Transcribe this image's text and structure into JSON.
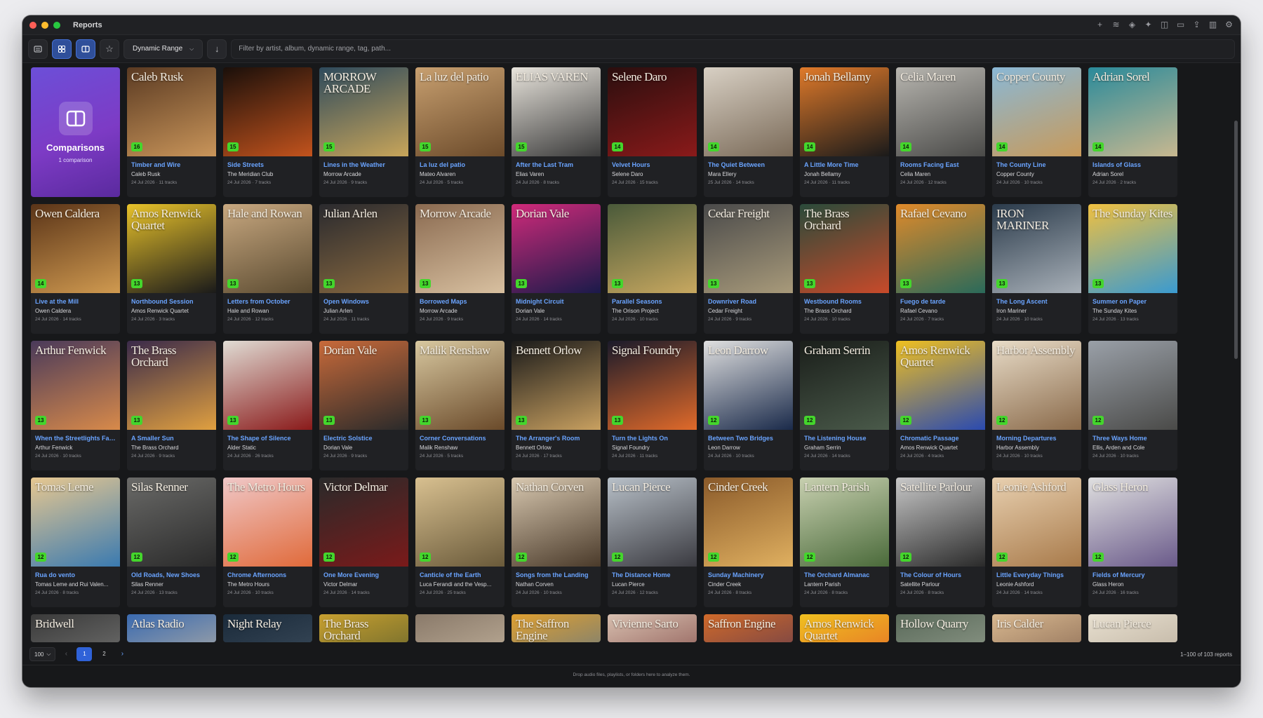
{
  "window": {
    "title": "Reports"
  },
  "toolbar": {
    "sort_label": "Dynamic Range",
    "filter_placeholder": "Filter by artist, album, dynamic range, tag, path..."
  },
  "comparisons": {
    "title": "Comparisons",
    "subtitle": "1 comparison"
  },
  "albums": [
    {
      "title": "Timber and Wire",
      "artist": "Caleb Rusk",
      "date": "24 Jul 2026 · 11 tracks",
      "score": "16",
      "cover_text": "Caleb Rusk",
      "colors": [
        "#5a3a22",
        "#c9955a"
      ]
    },
    {
      "title": "Side Streets",
      "artist": "The Meridian Club",
      "date": "24 Jul 2026 · 7 tracks",
      "score": "15",
      "cover_text": "",
      "colors": [
        "#1a0f0a",
        "#c2531d"
      ]
    },
    {
      "title": "Lines in the Weather",
      "artist": "Morrow Arcade",
      "date": "24 Jul 2026 · 9 tracks",
      "score": "15",
      "cover_text": "MORROW ARCADE",
      "colors": [
        "#2e4a5c",
        "#c8a55a"
      ]
    },
    {
      "title": "La luz del patio",
      "artist": "Mateo Alvaren",
      "date": "24 Jul 2026 · 5 tracks",
      "score": "15",
      "cover_text": "La luz del patio",
      "colors": [
        "#c8a070",
        "#6b4a2a"
      ]
    },
    {
      "title": "After the Last Tram",
      "artist": "Elias Varen",
      "date": "24 Jul 2026 · 8 tracks",
      "score": "15",
      "cover_text": "ELIAS VAREN",
      "colors": [
        "#e8e4dc",
        "#3a3a3a"
      ]
    },
    {
      "title": "Velvet Hours",
      "artist": "Selene Daro",
      "date": "24 Jul 2026 · 15 tracks",
      "score": "14",
      "cover_text": "Selene Daro",
      "colors": [
        "#2a0e0e",
        "#8a1a1a"
      ]
    },
    {
      "title": "The Quiet Between",
      "artist": "Mara Ellery",
      "date": "25 Jul 2026 · 14 tracks",
      "score": "14",
      "cover_text": "",
      "colors": [
        "#d8d0c4",
        "#7a6a58"
      ]
    },
    {
      "title": "A Little More Time",
      "artist": "Jonah Bellamy",
      "date": "24 Jul 2026 · 11 tracks",
      "score": "14",
      "cover_text": "Jonah Bellamy",
      "colors": [
        "#e07a2a",
        "#1a1a1a"
      ]
    },
    {
      "title": "Rooms Facing East",
      "artist": "Celia Maren",
      "date": "24 Jul 2026 · 12 tracks",
      "score": "14",
      "cover_text": "Celia Maren",
      "colors": [
        "#b8b6b0",
        "#4a4a48"
      ]
    },
    {
      "title": "The County Line",
      "artist": "Copper County",
      "date": "24 Jul 2026 · 10 tracks",
      "score": "14",
      "cover_text": "Copper County",
      "colors": [
        "#8ab8d6",
        "#c89a5a"
      ]
    },
    {
      "title": "Islands of Glass",
      "artist": "Adrian Sorel",
      "date": "24 Jul 2026 · 2 tracks",
      "score": "14",
      "cover_text": "Adrian Sorel",
      "colors": [
        "#2a8a9a",
        "#c8b890"
      ]
    },
    {
      "title": "Live at the Mill",
      "artist": "Owen Caldera",
      "date": "24 Jul 2026 · 14 tracks",
      "score": "14",
      "cover_text": "Owen Caldera",
      "colors": [
        "#5a3418",
        "#d09a50"
      ]
    },
    {
      "title": "Northbound Session",
      "artist": "Amos Renwick Quartet",
      "date": "24 Jul 2026 · 3 tracks",
      "score": "13",
      "cover_text": "Amos Renwick Quartet",
      "colors": [
        "#e8c22a",
        "#1a1a1a"
      ]
    },
    {
      "title": "Letters from October",
      "artist": "Hale and Rowan",
      "date": "24 Jul 2026 · 12 tracks",
      "score": "13",
      "cover_text": "Hale and Rowan",
      "colors": [
        "#c8a880",
        "#5a4a30"
      ]
    },
    {
      "title": "Open Windows",
      "artist": "Julian Arlen",
      "date": "24 Jul 2026 · 11 tracks",
      "score": "13",
      "cover_text": "Julian Arlen",
      "colors": [
        "#2a2a2e",
        "#8a6a40"
      ]
    },
    {
      "title": "Borrowed Maps",
      "artist": "Morrow Arcade",
      "date": "24 Jul 2026 · 9 tracks",
      "score": "13",
      "cover_text": "Morrow Arcade",
      "colors": [
        "#8a6a50",
        "#d8c0a0"
      ]
    },
    {
      "title": "Midnight Circuit",
      "artist": "Dorian Vale",
      "date": "24 Jul 2026 · 14 tracks",
      "score": "13",
      "cover_text": "Dorian Vale",
      "colors": [
        "#d02a7a",
        "#1a1a4a"
      ]
    },
    {
      "title": "Parallel Seasons",
      "artist": "The Orison Project",
      "date": "24 Jul 2026 · 10 tracks",
      "score": "13",
      "cover_text": "",
      "colors": [
        "#4a5a3a",
        "#c8a860"
      ]
    },
    {
      "title": "Downriver Road",
      "artist": "Cedar Freight",
      "date": "24 Jul 2026 · 9 tracks",
      "score": "13",
      "cover_text": "Cedar Freight",
      "colors": [
        "#4a4a4a",
        "#a89a7a"
      ]
    },
    {
      "title": "Westbound Rooms",
      "artist": "The Brass Orchard",
      "date": "24 Jul 2026 · 10 tracks",
      "score": "13",
      "cover_text": "The Brass Orchard",
      "colors": [
        "#2a4a3a",
        "#c84a2a"
      ]
    },
    {
      "title": "Fuego de tarde",
      "artist": "Rafael Cevano",
      "date": "24 Jul 2026 · 7 tracks",
      "score": "13",
      "cover_text": "Rafael Cevano",
      "colors": [
        "#e08a2a",
        "#2a6a5a"
      ]
    },
    {
      "title": "The Long Ascent",
      "artist": "Iron Mariner",
      "date": "24 Jul 2026 · 10 tracks",
      "score": "13",
      "cover_text": "IRON MARINER",
      "colors": [
        "#2a3a4a",
        "#a8b0b8"
      ]
    },
    {
      "title": "Summer on Paper",
      "artist": "The Sunday Kites",
      "date": "24 Jul 2026 · 13 tracks",
      "score": "13",
      "cover_text": "The Sunday Kites",
      "colors": [
        "#f0c040",
        "#3a9ad0"
      ]
    },
    {
      "title": "When the Streetlights Fade",
      "artist": "Arthur Fenwick",
      "date": "24 Jul 2026 · 10 tracks",
      "score": "13",
      "cover_text": "Arthur Fenwick",
      "colors": [
        "#4a3a5a",
        "#d88a4a"
      ]
    },
    {
      "title": "A Smaller Sun",
      "artist": "The Brass Orchard",
      "date": "24 Jul 2026 · 9 tracks",
      "score": "13",
      "cover_text": "The Brass Orchard",
      "colors": [
        "#3a2a4a",
        "#e0a040"
      ]
    },
    {
      "title": "The Shape of Silence",
      "artist": "Alder Static",
      "date": "24 Jul 2026 · 26 tracks",
      "score": "13",
      "cover_text": "",
      "colors": [
        "#e0dcd4",
        "#8a1a1a"
      ]
    },
    {
      "title": "Electric Solstice",
      "artist": "Dorian Vale",
      "date": "24 Jul 2026 · 9 tracks",
      "score": "13",
      "cover_text": "Dorian Vale",
      "colors": [
        "#c86a3a",
        "#2a2a2a"
      ]
    },
    {
      "title": "Corner Conversations",
      "artist": "Malik Renshaw",
      "date": "24 Jul 2026 · 5 tracks",
      "score": "13",
      "cover_text": "Malik Renshaw",
      "colors": [
        "#d8c8a0",
        "#6a4a2a"
      ]
    },
    {
      "title": "The Arranger's Room",
      "artist": "Bennett Orlow",
      "date": "24 Jul 2026 · 17 tracks",
      "score": "13",
      "cover_text": "Bennett Orlow",
      "colors": [
        "#1a1a1a",
        "#c8a060"
      ]
    },
    {
      "title": "Turn the Lights On",
      "artist": "Signal Foundry",
      "date": "24 Jul 2026 · 11 tracks",
      "score": "13",
      "cover_text": "Signal Foundry",
      "colors": [
        "#1a1a2a",
        "#e06a2a"
      ]
    },
    {
      "title": "Between Two Bridges",
      "artist": "Leon Darrow",
      "date": "24 Jul 2026 · 10 tracks",
      "score": "12",
      "cover_text": "Leon Darrow",
      "colors": [
        "#e0e0e0",
        "#1a2a4a"
      ]
    },
    {
      "title": "The Listening House",
      "artist": "Graham Serrin",
      "date": "24 Jul 2026 · 14 tracks",
      "score": "12",
      "cover_text": "Graham Serrin",
      "colors": [
        "#1a1e1a",
        "#4a5a4a"
      ]
    },
    {
      "title": "Chromatic Passage",
      "artist": "Amos Renwick Quartet",
      "date": "24 Jul 2026 · 4 tracks",
      "score": "12",
      "cover_text": "Amos Renwick Quartet",
      "colors": [
        "#f0c020",
        "#2a4ab0"
      ]
    },
    {
      "title": "Morning Departures",
      "artist": "Harbor Assembly",
      "date": "24 Jul 2026 · 10 tracks",
      "score": "12",
      "cover_text": "Harbor Assembly",
      "colors": [
        "#e8dcc8",
        "#8a6a4a"
      ]
    },
    {
      "title": "Three Ways Home",
      "artist": "Ellis, Arden and Cole",
      "date": "24 Jul 2026 · 10 tracks",
      "score": "12",
      "cover_text": "",
      "colors": [
        "#9aa0a8",
        "#4a4a48"
      ]
    },
    {
      "title": "Rua do vento",
      "artist": "Tomas Leme and Rui Valen...",
      "date": "24 Jul 2026 · 8 tracks",
      "score": "12",
      "cover_text": "Tomas Leme",
      "colors": [
        "#e8c890",
        "#3a7ab0"
      ]
    },
    {
      "title": "Old Roads, New Shoes",
      "artist": "Silas Renner",
      "date": "24 Jul 2026 · 13 tracks",
      "score": "12",
      "cover_text": "Silas Renner",
      "colors": [
        "#6a6a68",
        "#2a2a2a"
      ]
    },
    {
      "title": "Chrome Afternoons",
      "artist": "The Metro Hours",
      "date": "24 Jul 2026 · 10 tracks",
      "score": "12",
      "cover_text": "The Metro Hours",
      "colors": [
        "#f0c8c8",
        "#e06a3a"
      ]
    },
    {
      "title": "One More Evening",
      "artist": "Victor Delmar",
      "date": "24 Jul 2026 · 14 tracks",
      "score": "12",
      "cover_text": "Victor Delmar",
      "colors": [
        "#2a2a2a",
        "#7a1a1a"
      ]
    },
    {
      "title": "Canticle of the Earth",
      "artist": "Luca Ferandi and the Vesp...",
      "date": "24 Jul 2026 · 25 tracks",
      "score": "12",
      "cover_text": "",
      "colors": [
        "#d8c090",
        "#6a5a3a"
      ]
    },
    {
      "title": "Songs from the Landing",
      "artist": "Nathan Corven",
      "date": "24 Jul 2026 · 10 tracks",
      "score": "12",
      "cover_text": "Nathan Corven",
      "colors": [
        "#d8c8b0",
        "#4a3a2a"
      ]
    },
    {
      "title": "The Distance Home",
      "artist": "Lucan Pierce",
      "date": "24 Jul 2026 · 12 tracks",
      "score": "12",
      "cover_text": "Lucan Pierce",
      "colors": [
        "#b8c0c8",
        "#3a3a40"
      ]
    },
    {
      "title": "Sunday Machinery",
      "artist": "Cinder Creek",
      "date": "24 Jul 2026 · 8 tracks",
      "score": "12",
      "cover_text": "Cinder Creek",
      "colors": [
        "#8a5a2a",
        "#e0b060"
      ]
    },
    {
      "title": "The Orchard Almanac",
      "artist": "Lantern Parish",
      "date": "24 Jul 2026 · 8 tracks",
      "score": "12",
      "cover_text": "Lantern Parish",
      "colors": [
        "#c8d0b0",
        "#4a6a3a"
      ]
    },
    {
      "title": "The Colour of Hours",
      "artist": "Satellite Parlour",
      "date": "24 Jul 2026 · 8 tracks",
      "score": "12",
      "cover_text": "Satellite Parlour",
      "colors": [
        "#c8c8c8",
        "#2a2a2a"
      ]
    },
    {
      "title": "Little Everyday Things",
      "artist": "Leonie Ashford",
      "date": "24 Jul 2026 · 14 tracks",
      "score": "12",
      "cover_text": "Leonie Ashford",
      "colors": [
        "#e8d0b0",
        "#a87a4a"
      ]
    },
    {
      "title": "Fields of Mercury",
      "artist": "Glass Heron",
      "date": "24 Jul 2026 · 16 tracks",
      "score": "12",
      "cover_text": "Glass Heron",
      "colors": [
        "#e0e0e0",
        "#6a5a8a"
      ]
    }
  ],
  "partial_row": [
    {
      "cover_text": "Bridwell",
      "colors": [
        "#3a3a3a",
        "#8a8a88"
      ]
    },
    {
      "cover_text": "Atlas Radio",
      "colors": [
        "#3a6ab0",
        "#e0c8a0"
      ]
    },
    {
      "cover_text": "Night Relay",
      "colors": [
        "#1a2a3a",
        "#4a5a6a"
      ]
    },
    {
      "cover_text": "The Brass Orchard",
      "colors": [
        "#c8a030",
        "#3a4a2a"
      ]
    },
    {
      "cover_text": "",
      "colors": [
        "#8a7a6a",
        "#d8c8b0"
      ]
    },
    {
      "cover_text": "The Saffron Engine",
      "colors": [
        "#e0a030",
        "#3a6aa0"
      ]
    },
    {
      "cover_text": "Vivienne Sarto",
      "colors": [
        "#d8c0b0",
        "#6a2a2a"
      ]
    },
    {
      "cover_text": "Saffron Engine",
      "colors": [
        "#d06a2a",
        "#3a2a5a"
      ]
    },
    {
      "cover_text": "Amos Renwick Quartet",
      "colors": [
        "#f0c020",
        "#e04a2a"
      ]
    },
    {
      "cover_text": "Hollow Quarry",
      "colors": [
        "#5a6a5a",
        "#a8b0a0"
      ]
    },
    {
      "cover_text": "Iris Calder",
      "colors": [
        "#d8b890",
        "#6a4a3a"
      ]
    },
    {
      "cover_text": "Lucan Pierce",
      "colors": [
        "#e8e0d0",
        "#a89a88"
      ]
    }
  ],
  "pagination": {
    "page_size": "100",
    "pages": [
      "1",
      "2"
    ],
    "current": "1",
    "summary": "1–100 of 103 reports"
  },
  "footer": {
    "drop_hint": "Drop audio files, playlists, or folders here to analyze them."
  }
}
